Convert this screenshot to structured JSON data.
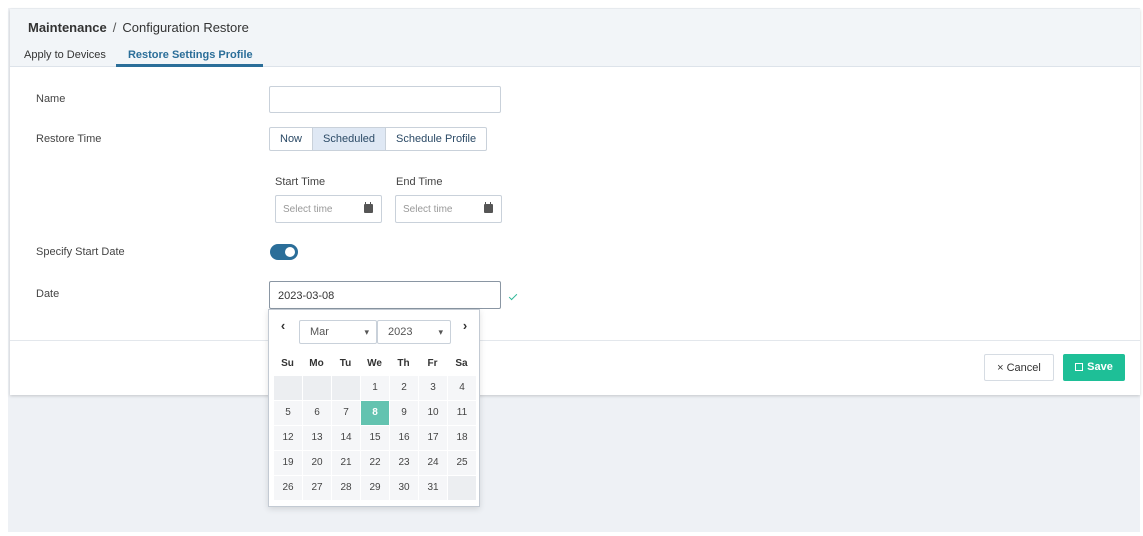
{
  "breadcrumb": {
    "section": "Maintenance",
    "separator": "/",
    "page": "Configuration Restore"
  },
  "tabs": [
    {
      "label": "Apply to Devices",
      "active": false
    },
    {
      "label": "Restore Settings Profile",
      "active": true
    }
  ],
  "form": {
    "name_label": "Name",
    "name_value": "",
    "restore_time_label": "Restore Time",
    "restore_options": [
      "Now",
      "Scheduled",
      "Schedule Profile"
    ],
    "restore_selected": "Scheduled",
    "start_time_label": "Start Time",
    "start_time_placeholder": "Select time",
    "end_time_label": "End Time",
    "end_time_placeholder": "Select time",
    "specify_start_date_label": "Specify Start Date",
    "specify_start_date_enabled": true,
    "date_label": "Date",
    "date_value": "2023-03-08"
  },
  "datepicker": {
    "prev_icon": "chevron-left-icon",
    "next_icon": "chevron-right-icon",
    "month": "Mar",
    "year": "2023",
    "weekdays": [
      "Su",
      "Mo",
      "Tu",
      "We",
      "Th",
      "Fr",
      "Sa"
    ],
    "weeks": [
      [
        "",
        "",
        "",
        "1",
        "2",
        "3",
        "4"
      ],
      [
        "5",
        "6",
        "7",
        "8",
        "9",
        "10",
        "11"
      ],
      [
        "12",
        "13",
        "14",
        "15",
        "16",
        "17",
        "18"
      ],
      [
        "19",
        "20",
        "21",
        "22",
        "23",
        "24",
        "25"
      ],
      [
        "26",
        "27",
        "28",
        "29",
        "30",
        "31",
        ""
      ]
    ],
    "selected_day": "8"
  },
  "actions": {
    "cancel_label": "× Cancel",
    "save_label": "Save"
  },
  "colors": {
    "accent": "#2b6e99",
    "save": "#1ebf97",
    "selected_day": "#63c3b0"
  }
}
